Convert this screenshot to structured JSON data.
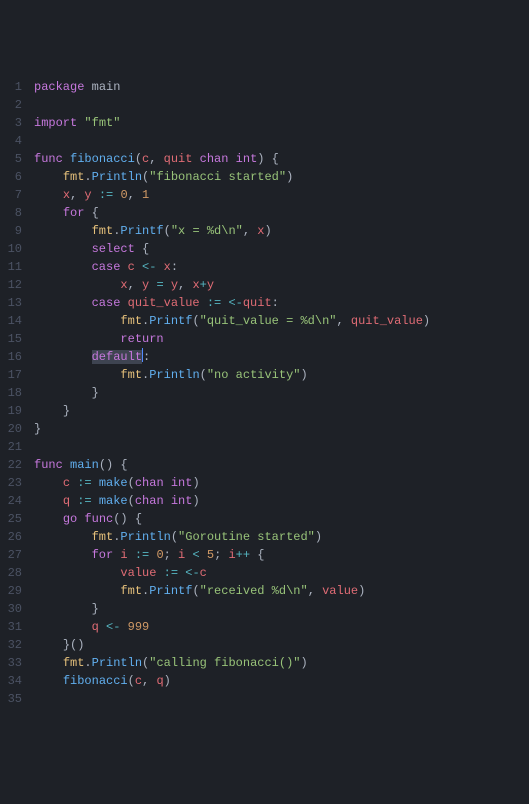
{
  "language": "go",
  "gutter": [
    "1",
    "2",
    "3",
    "4",
    "5",
    "6",
    "7",
    "8",
    "9",
    "10",
    "11",
    "12",
    "13",
    "14",
    "15",
    "16",
    "17",
    "18",
    "19",
    "20",
    "21",
    "22",
    "23",
    "24",
    "25",
    "26",
    "27",
    "28",
    "29",
    "30",
    "31",
    "32",
    "33",
    "34",
    "35"
  ],
  "selection": {
    "line": 16,
    "text": "default"
  },
  "code": {
    "l1": {
      "kw_package": "package",
      "pkg": "main"
    },
    "l3": {
      "kw_import": "import",
      "mod": "\"fmt\""
    },
    "l5": {
      "kw_func": "func",
      "name": "fibonacci",
      "p1": "c",
      "p2": "quit",
      "kw_chan": "chan",
      "kw_int": "int"
    },
    "l6": {
      "recv": "fmt",
      "fn": "Println",
      "arg": "\"fibonacci started\""
    },
    "l7": {
      "x": "x",
      "y": "y",
      "assign": ":=",
      "n0": "0",
      "n1": "1"
    },
    "l8": {
      "kw_for": "for"
    },
    "l9": {
      "recv": "fmt",
      "fn": "Printf",
      "fmtstr": "\"x = %d\\n\"",
      "arg": "x"
    },
    "l10": {
      "kw_select": "select"
    },
    "l11": {
      "kw_case": "case",
      "c": "c",
      "arrow": "<-",
      "x": "x"
    },
    "l12": {
      "x": "x",
      "y": "y",
      "eq": "=",
      "y2": "y",
      "xplusy": "x+y"
    },
    "l13": {
      "kw_case": "case",
      "qv": "quit_value",
      "assign": ":=",
      "arrow": "<-",
      "quit": "quit"
    },
    "l14": {
      "recv": "fmt",
      "fn": "Printf",
      "fmtstr": "\"quit_value = %d\\n\"",
      "arg": "quit_value"
    },
    "l15": {
      "kw_return": "return"
    },
    "l16": {
      "kw_default": "default"
    },
    "l17": {
      "recv": "fmt",
      "fn": "Println",
      "arg": "\"no activity\""
    },
    "l22": {
      "kw_func": "func",
      "name": "main"
    },
    "l23": {
      "c": "c",
      "assign": ":=",
      "make": "make",
      "kw_chan": "chan",
      "kw_int": "int"
    },
    "l24": {
      "q": "q",
      "assign": ":=",
      "make": "make",
      "kw_chan": "chan",
      "kw_int": "int"
    },
    "l25": {
      "kw_go": "go",
      "kw_func": "func"
    },
    "l26": {
      "recv": "fmt",
      "fn": "Println",
      "arg": "\"Goroutine started\""
    },
    "l27": {
      "kw_for": "for",
      "i": "i",
      "assign": ":=",
      "n0": "0",
      "i2": "i",
      "lt": "<",
      "n5": "5",
      "i3": "i",
      "pp": "++"
    },
    "l28": {
      "val": "value",
      "assign": ":=",
      "arrow": "<-",
      "c": "c"
    },
    "l29": {
      "recv": "fmt",
      "fn": "Printf",
      "fmtstr": "\"received %d\\n\"",
      "arg": "value"
    },
    "l31": {
      "q": "q",
      "arrow": "<-",
      "n": "999"
    },
    "l33": {
      "recv": "fmt",
      "fn": "Println",
      "arg": "\"calling fibonacci()\""
    },
    "l34": {
      "fn": "fibonacci",
      "a1": "c",
      "a2": "q"
    }
  }
}
